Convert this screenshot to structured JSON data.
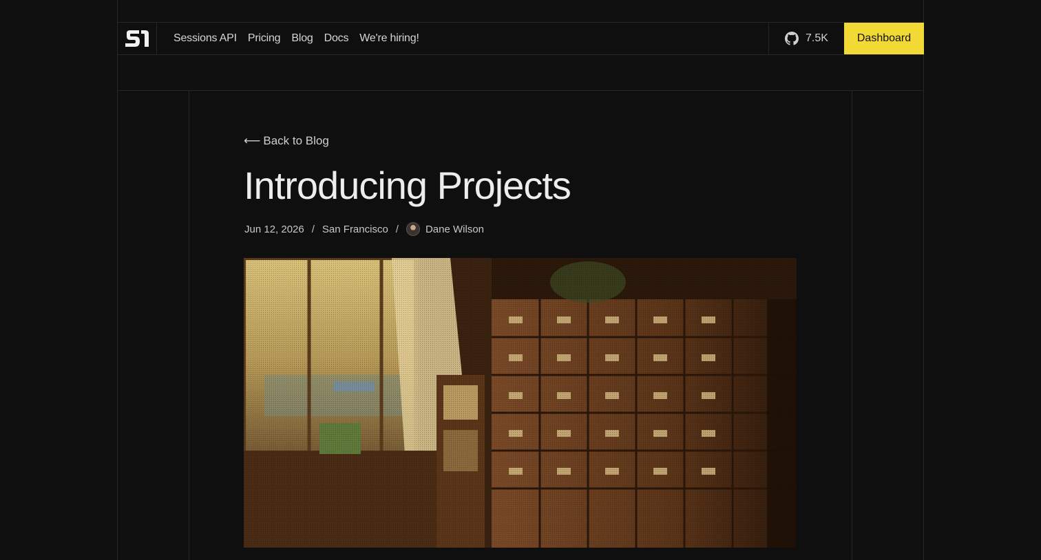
{
  "nav": {
    "links": [
      "Sessions API",
      "Pricing",
      "Blog",
      "Docs",
      "We're hiring!"
    ],
    "github_stars": "7.5K",
    "dashboard_label": "Dashboard"
  },
  "post": {
    "back_label": "Back to Blog",
    "title": "Introducing Projects",
    "date": "Jun 12, 2026",
    "location": "San Francisco",
    "author": "Dane Wilson"
  },
  "colors": {
    "background": "#0f0f0f",
    "accent": "#f2d935",
    "border": "#262626"
  }
}
